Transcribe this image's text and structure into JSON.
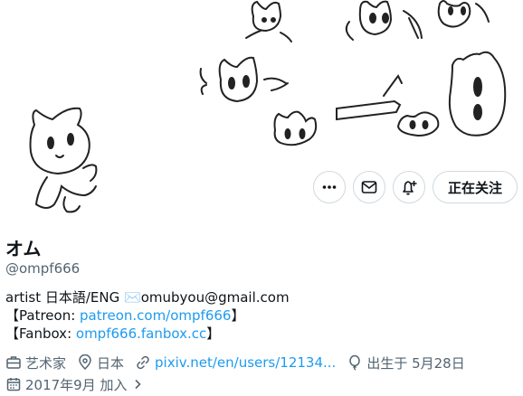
{
  "profile": {
    "display_name": "オム",
    "handle": "@ompf666"
  },
  "actions": {
    "more_icon": "more-icon",
    "message_icon": "mail-icon",
    "notify_icon": "bell-plus-icon",
    "follow_label": "正在关注"
  },
  "bio": {
    "line1_text": "artist 日本語/ENG ",
    "line1_emoji": "✉️",
    "line1_email": "omubyou@gmail.com",
    "patreon_prefix": "【Patreon: ",
    "patreon_link": "patreon.com/ompf666",
    "patreon_suffix": "】",
    "fanbox_prefix": "【Fanbox: ",
    "fanbox_link": "ompf666.fanbox.cc",
    "fanbox_suffix": "】"
  },
  "meta": {
    "category": "艺术家",
    "location": "日本",
    "website": "pixiv.net/en/users/12134...",
    "birthday": "出生于 5月28日",
    "joined": "2017年9月 加入"
  },
  "colors": {
    "link": "#1d9bf0",
    "secondary_text": "#536471",
    "border": "#cfd9de"
  }
}
